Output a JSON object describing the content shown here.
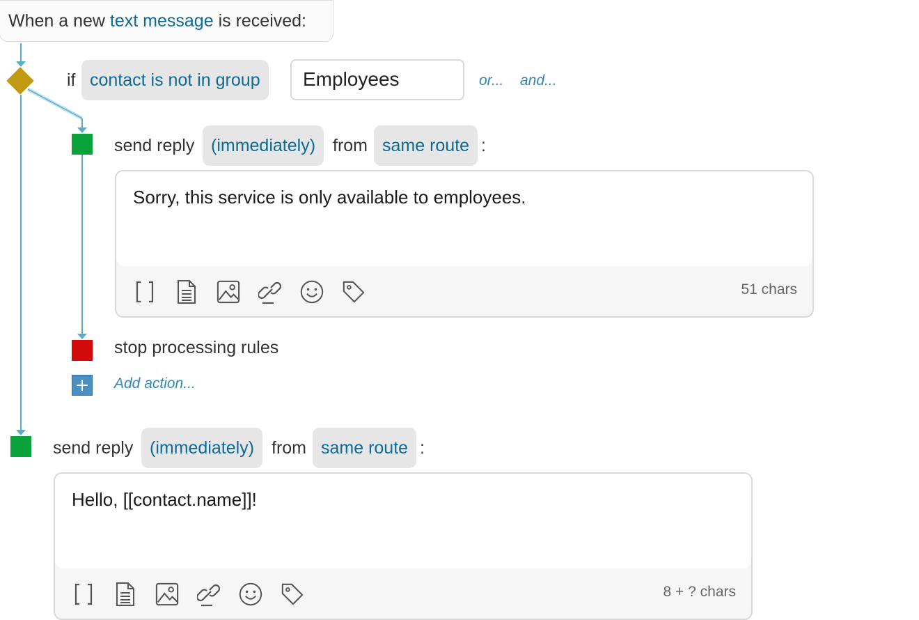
{
  "trigger": {
    "prefix": "When a new",
    "event_link": "text message",
    "suffix": "is received:"
  },
  "condition": {
    "if_label": "if",
    "operator": "contact is not in group",
    "group_value": "Employees",
    "or_link": "or...",
    "and_link": "and..."
  },
  "branch_actions": {
    "reply": {
      "label": "send reply",
      "timing": "(immediately)",
      "from_label": "from",
      "route": "same route",
      "colon": ":",
      "message": "Sorry, this service is only available to employees.",
      "char_count": "51 chars"
    },
    "stop_label": "stop processing rules",
    "add_action": "Add action..."
  },
  "main_action": {
    "label": "send reply",
    "timing": "(immediately)",
    "from_label": "from",
    "route": "same route",
    "colon": ":",
    "message": "Hello, [[contact.name]]!",
    "char_count": "8 + ? chars"
  },
  "toolbar_icons": [
    "brackets-icon",
    "document-icon",
    "image-icon",
    "link-icon",
    "emoji-icon",
    "tag-icon"
  ],
  "colors": {
    "link": "#0c6b96",
    "connector": "#5aaec9",
    "condition_node": "#c29a11",
    "action_node": "#0aa23a",
    "stop_node": "#d20a0a",
    "add_node": "#4a8fc2"
  }
}
